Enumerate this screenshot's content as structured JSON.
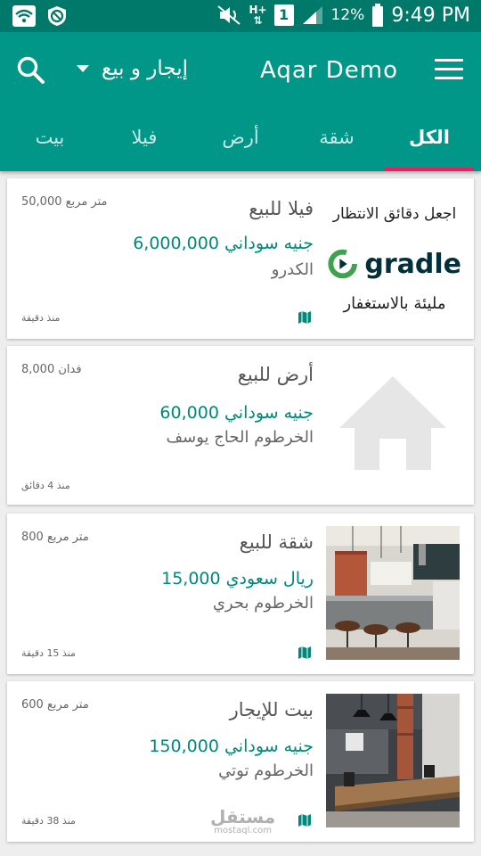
{
  "status_bar": {
    "time": "9:49 PM",
    "battery_percent": "12%",
    "network_box": "1",
    "hplus": "H+",
    "icons": [
      "wifi-icon",
      "blocked-icon",
      "mute-icon",
      "data-arrows-icon",
      "signal-icon",
      "battery-icon"
    ]
  },
  "app_bar": {
    "title": "Aqar Demo",
    "mode_label": "إيجار و بيع",
    "tabs": [
      "الكل",
      "شقة",
      "أرض",
      "فيلا",
      "بيت"
    ],
    "active_tab": 0
  },
  "ad": {
    "top_text": "اجعل دقائق الانتظار",
    "brand": "gradle",
    "bottom_text": "مليئة بالاستغفار"
  },
  "listings": [
    {
      "title": "فيلا للبيع",
      "price": "6,000,000 جنيه سوداني",
      "location": "الكدرو",
      "area": "50,000 متر مربع",
      "time": "منذ دقيقة"
    },
    {
      "title": "أرض للبيع",
      "price": "60,000 جنيه سوداني",
      "location": "الخرطوم الحاج يوسف",
      "area": "8,000 فدان",
      "time": "منذ 4 دقائق"
    },
    {
      "title": "شقة للبيع",
      "price": "15,000 ريال سعودي",
      "location": "الخرطوم بحري",
      "area": "800 متر مربع",
      "time": "منذ 15 دقيقة"
    },
    {
      "title": "بيت للإيجار",
      "price": "150,000 جنيه سوداني",
      "location": "الخرطوم توتي",
      "area": "600 متر مربع",
      "time": "منذ 38 دقيقة"
    }
  ],
  "watermark": {
    "line1": "مستقل",
    "line2": "mostaql.com"
  },
  "colors": {
    "primary": "#009688",
    "primary_dark": "#00796b",
    "accent": "#e91e63",
    "price": "#00897b"
  }
}
